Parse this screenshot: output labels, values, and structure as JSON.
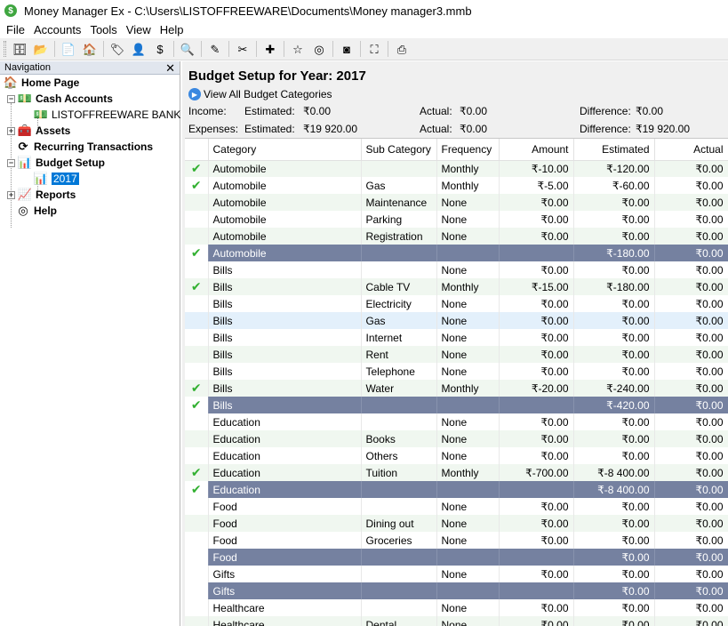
{
  "window": {
    "title": "Money Manager Ex - C:\\Users\\LISTOFFREEWARE\\Documents\\Money manager3.mmb",
    "app_icon": "$"
  },
  "menu": [
    "File",
    "Accounts",
    "Tools",
    "View",
    "Help"
  ],
  "toolbar": {
    "groups": [
      [
        {
          "name": "database-icon",
          "glyph": "🗄"
        },
        {
          "name": "open-folder-icon",
          "glyph": "📂"
        }
      ],
      [
        {
          "name": "new-document-icon",
          "glyph": "📄"
        },
        {
          "name": "home-icon",
          "glyph": "🏠"
        }
      ],
      [
        {
          "name": "tag-icon",
          "glyph": "🏷"
        },
        {
          "name": "payee-icon",
          "glyph": "👤"
        },
        {
          "name": "currency-icon",
          "glyph": "$"
        }
      ],
      [
        {
          "name": "filter-icon",
          "glyph": "🔍"
        }
      ],
      [
        {
          "name": "edit-icon",
          "glyph": "✎"
        }
      ],
      [
        {
          "name": "tools-icon",
          "glyph": "✂"
        }
      ],
      [
        {
          "name": "add-icon",
          "glyph": "✚"
        }
      ],
      [
        {
          "name": "star-icon",
          "glyph": "☆"
        },
        {
          "name": "help-lifebuoy-icon",
          "glyph": "◎"
        }
      ],
      [
        {
          "name": "rss-icon",
          "glyph": "◙"
        }
      ],
      [
        {
          "name": "fullscreen-icon",
          "glyph": "⛶"
        }
      ],
      [
        {
          "name": "print-icon",
          "glyph": "⎙"
        }
      ]
    ]
  },
  "navigation": {
    "header": "Navigation",
    "close_glyph": "✕",
    "items": [
      {
        "label": "Home Page",
        "bold": true,
        "icon": "home-icon",
        "glyph": "🏠"
      },
      {
        "label": "Cash Accounts",
        "bold": true,
        "icon": "cash-accounts-icon",
        "glyph": "💵"
      },
      {
        "label": "LISTOFFREEWARE BANK",
        "bold": false,
        "icon": "bank-account-icon",
        "glyph": "💵"
      },
      {
        "label": "Assets",
        "bold": true,
        "icon": "assets-icon",
        "glyph": "🧰"
      },
      {
        "label": "Recurring Transactions",
        "bold": true,
        "icon": "recurring-transactions-icon",
        "glyph": "⟳"
      },
      {
        "label": "Budget Setup",
        "bold": true,
        "icon": "budget-setup-icon",
        "glyph": "📊"
      },
      {
        "label": "2017",
        "bold": false,
        "icon": "budget-year-icon",
        "glyph": "📊"
      },
      {
        "label": "Reports",
        "bold": true,
        "icon": "reports-icon",
        "glyph": "📈"
      },
      {
        "label": "Help",
        "bold": true,
        "icon": "help-icon",
        "glyph": "◎"
      }
    ]
  },
  "main": {
    "title": "Budget Setup for Year: 2017",
    "view_all_label": "View All Budget Categories",
    "income": {
      "label": "Income:",
      "estimated_label": "Estimated:",
      "estimated": "₹0.00",
      "actual_label": "Actual:",
      "actual": "₹0.00",
      "difference_label": "Difference:",
      "difference": "₹0.00"
    },
    "expenses": {
      "label": "Expenses:",
      "estimated_label": "Estimated:",
      "estimated": "₹19 920.00",
      "actual_label": "Actual:",
      "actual": "₹0.00",
      "difference_label": "Difference:",
      "difference": "₹19 920.00"
    },
    "columns": [
      "",
      "Category",
      "Sub Category",
      "Frequency",
      "Amount",
      "Estimated",
      "Actual"
    ],
    "rows": [
      {
        "check": true,
        "category": "Automobile",
        "sub": "",
        "freq": "Monthly",
        "amount": "₹-10.00",
        "est": "₹-120.00",
        "actual": "₹0.00",
        "kind": "alt"
      },
      {
        "check": true,
        "category": "Automobile",
        "sub": "Gas",
        "freq": "Monthly",
        "amount": "₹-5.00",
        "est": "₹-60.00",
        "actual": "₹0.00",
        "kind": ""
      },
      {
        "check": false,
        "category": "Automobile",
        "sub": "Maintenance",
        "freq": "None",
        "amount": "₹0.00",
        "est": "₹0.00",
        "actual": "₹0.00",
        "kind": "alt"
      },
      {
        "check": false,
        "category": "Automobile",
        "sub": "Parking",
        "freq": "None",
        "amount": "₹0.00",
        "est": "₹0.00",
        "actual": "₹0.00",
        "kind": ""
      },
      {
        "check": false,
        "category": "Automobile",
        "sub": "Registration",
        "freq": "None",
        "amount": "₹0.00",
        "est": "₹0.00",
        "actual": "₹0.00",
        "kind": "alt"
      },
      {
        "check": true,
        "category": "Automobile",
        "sub": "",
        "freq": "",
        "amount": "",
        "est": "₹-180.00",
        "actual": "₹0.00",
        "kind": "total"
      },
      {
        "check": false,
        "category": "Bills",
        "sub": "",
        "freq": "None",
        "amount": "₹0.00",
        "est": "₹0.00",
        "actual": "₹0.00",
        "kind": ""
      },
      {
        "check": true,
        "category": "Bills",
        "sub": "Cable TV",
        "freq": "Monthly",
        "amount": "₹-15.00",
        "est": "₹-180.00",
        "actual": "₹0.00",
        "kind": "alt"
      },
      {
        "check": false,
        "category": "Bills",
        "sub": "Electricity",
        "freq": "None",
        "amount": "₹0.00",
        "est": "₹0.00",
        "actual": "₹0.00",
        "kind": ""
      },
      {
        "check": false,
        "category": "Bills",
        "sub": "Gas",
        "freq": "None",
        "amount": "₹0.00",
        "est": "₹0.00",
        "actual": "₹0.00",
        "kind": "row-hl"
      },
      {
        "check": false,
        "category": "Bills",
        "sub": "Internet",
        "freq": "None",
        "amount": "₹0.00",
        "est": "₹0.00",
        "actual": "₹0.00",
        "kind": ""
      },
      {
        "check": false,
        "category": "Bills",
        "sub": "Rent",
        "freq": "None",
        "amount": "₹0.00",
        "est": "₹0.00",
        "actual": "₹0.00",
        "kind": "alt"
      },
      {
        "check": false,
        "category": "Bills",
        "sub": "Telephone",
        "freq": "None",
        "amount": "₹0.00",
        "est": "₹0.00",
        "actual": "₹0.00",
        "kind": ""
      },
      {
        "check": true,
        "category": "Bills",
        "sub": "Water",
        "freq": "Monthly",
        "amount": "₹-20.00",
        "est": "₹-240.00",
        "actual": "₹0.00",
        "kind": "alt"
      },
      {
        "check": true,
        "category": "Bills",
        "sub": "",
        "freq": "",
        "amount": "",
        "est": "₹-420.00",
        "actual": "₹0.00",
        "kind": "total"
      },
      {
        "check": false,
        "category": "Education",
        "sub": "",
        "freq": "None",
        "amount": "₹0.00",
        "est": "₹0.00",
        "actual": "₹0.00",
        "kind": ""
      },
      {
        "check": false,
        "category": "Education",
        "sub": "Books",
        "freq": "None",
        "amount": "₹0.00",
        "est": "₹0.00",
        "actual": "₹0.00",
        "kind": "alt"
      },
      {
        "check": false,
        "category": "Education",
        "sub": "Others",
        "freq": "None",
        "amount": "₹0.00",
        "est": "₹0.00",
        "actual": "₹0.00",
        "kind": ""
      },
      {
        "check": true,
        "category": "Education",
        "sub": "Tuition",
        "freq": "Monthly",
        "amount": "₹-700.00",
        "est": "₹-8 400.00",
        "actual": "₹0.00",
        "kind": "alt"
      },
      {
        "check": true,
        "category": "Education",
        "sub": "",
        "freq": "",
        "amount": "",
        "est": "₹-8 400.00",
        "actual": "₹0.00",
        "kind": "total"
      },
      {
        "check": false,
        "category": "Food",
        "sub": "",
        "freq": "None",
        "amount": "₹0.00",
        "est": "₹0.00",
        "actual": "₹0.00",
        "kind": ""
      },
      {
        "check": false,
        "category": "Food",
        "sub": "Dining out",
        "freq": "None",
        "amount": "₹0.00",
        "est": "₹0.00",
        "actual": "₹0.00",
        "kind": "alt"
      },
      {
        "check": false,
        "category": "Food",
        "sub": "Groceries",
        "freq": "None",
        "amount": "₹0.00",
        "est": "₹0.00",
        "actual": "₹0.00",
        "kind": ""
      },
      {
        "check": false,
        "category": "Food",
        "sub": "",
        "freq": "",
        "amount": "",
        "est": "₹0.00",
        "actual": "₹0.00",
        "kind": "total"
      },
      {
        "check": false,
        "category": "Gifts",
        "sub": "",
        "freq": "None",
        "amount": "₹0.00",
        "est": "₹0.00",
        "actual": "₹0.00",
        "kind": ""
      },
      {
        "check": false,
        "category": "Gifts",
        "sub": "",
        "freq": "",
        "amount": "",
        "est": "₹0.00",
        "actual": "₹0.00",
        "kind": "total"
      },
      {
        "check": false,
        "category": "Healthcare",
        "sub": "",
        "freq": "None",
        "amount": "₹0.00",
        "est": "₹0.00",
        "actual": "₹0.00",
        "kind": ""
      },
      {
        "check": false,
        "category": "Healthcare",
        "sub": "Dental",
        "freq": "None",
        "amount": "₹0.00",
        "est": "₹0.00",
        "actual": "₹0.00",
        "kind": "alt"
      }
    ]
  },
  "colors": {
    "total_row": "#7581a0",
    "alt_row": "#f0f7f0",
    "highlight_row": "#e3f0fb",
    "check": "#32b031",
    "selection": "#0078d7"
  }
}
